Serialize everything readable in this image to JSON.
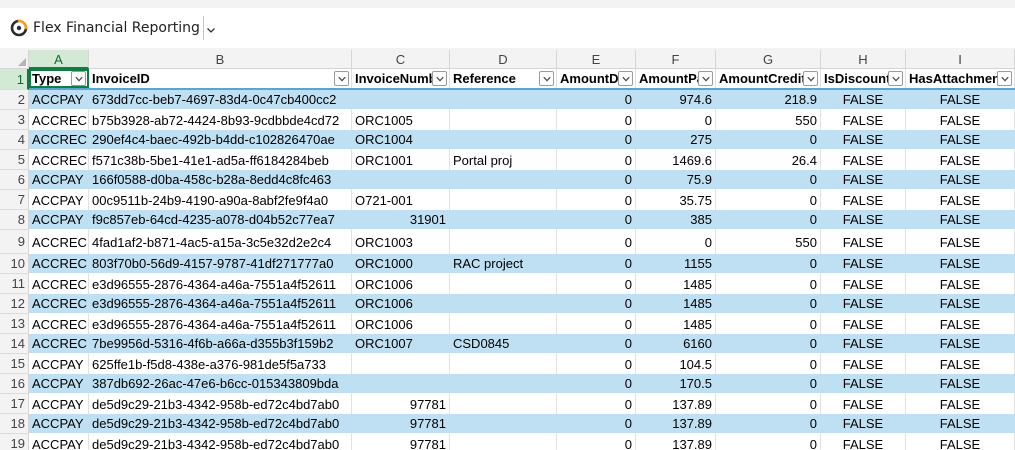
{
  "app": {
    "title": "Flex Financial Reporting",
    "logo_icon": "flex-logo-icon",
    "menu_icon": "chevron-down-icon"
  },
  "colors": {
    "band": "#bfe0f3",
    "selected_header": "#d3e9d6",
    "selected_accent": "#107c41",
    "table_header_rule": "#5ba4d0"
  },
  "column_letters": [
    "A",
    "B",
    "C",
    "D",
    "E",
    "F",
    "G",
    "H",
    "I"
  ],
  "selected_column": "A",
  "selected_row": "1",
  "row_numbers": [
    "1",
    "2",
    "3",
    "4",
    "5",
    "6",
    "7",
    "8",
    "9",
    "10",
    "11",
    "12",
    "13",
    "14",
    "15",
    "16",
    "17",
    "18",
    "19"
  ],
  "table": {
    "headers": [
      "Type",
      "InvoiceID",
      "InvoiceNumb",
      "Reference",
      "AmountDu",
      "AmountPa",
      "AmountCredite",
      "IsDiscounte",
      "HasAttachmen"
    ],
    "filter_icon": "filter-dropdown-icon",
    "rows": [
      [
        "ACCPAY",
        "673dd7cc-beb7-4697-83d4-0c47cb400cc2",
        "",
        "",
        "0",
        "974.6",
        "218.9",
        "FALSE",
        "FALSE"
      ],
      [
        "ACCREC",
        "b75b3928-ab72-4424-8b93-9cdbbde4cd72",
        "ORC1005",
        "",
        "0",
        "0",
        "550",
        "FALSE",
        "FALSE"
      ],
      [
        "ACCREC",
        "290ef4c4-baec-492b-b4dd-c102826470ae",
        "ORC1004",
        "",
        "0",
        "275",
        "0",
        "FALSE",
        "FALSE"
      ],
      [
        "ACCREC",
        "f571c38b-5be1-41e1-ad5a-ff6184284beb",
        "ORC1001",
        "Portal proj",
        "0",
        "1469.6",
        "26.4",
        "FALSE",
        "FALSE"
      ],
      [
        "ACCPAY",
        "166f0588-d0ba-458c-b28a-8edd4c8fc463",
        "",
        "",
        "0",
        "75.9",
        "0",
        "FALSE",
        "FALSE"
      ],
      [
        "ACCPAY",
        "00c9511b-24b9-4190-a90a-8abf2fe9f4a0",
        "O721-001",
        "",
        "0",
        "35.75",
        "0",
        "FALSE",
        "FALSE"
      ],
      [
        "ACCPAY",
        "f9c857eb-64cd-4235-a078-d04b52c77ea7",
        "31901",
        "",
        "0",
        "385",
        "0",
        "FALSE",
        "FALSE"
      ],
      [
        "ACCREC",
        "4fad1af2-b871-4ac5-a15a-3c5e32d2e2c4",
        "ORC1003",
        "",
        "0",
        "0",
        "550",
        "FALSE",
        "FALSE"
      ],
      [
        "ACCREC",
        "803f70b0-56d9-4157-9787-41df271777a0",
        "ORC1000",
        "RAC project",
        "0",
        "1155",
        "0",
        "FALSE",
        "FALSE"
      ],
      [
        "ACCREC",
        "e3d96555-2876-4364-a46a-7551a4f52611",
        "ORC1006",
        "",
        "0",
        "1485",
        "0",
        "FALSE",
        "FALSE"
      ],
      [
        "ACCREC",
        "e3d96555-2876-4364-a46a-7551a4f52611",
        "ORC1006",
        "",
        "0",
        "1485",
        "0",
        "FALSE",
        "FALSE"
      ],
      [
        "ACCREC",
        "e3d96555-2876-4364-a46a-7551a4f52611",
        "ORC1006",
        "",
        "0",
        "1485",
        "0",
        "FALSE",
        "FALSE"
      ],
      [
        "ACCREC",
        "7be9956d-5316-4f6b-a66a-d355b3f159b2",
        "ORC1007",
        "CSD0845",
        "0",
        "6160",
        "0",
        "FALSE",
        "FALSE"
      ],
      [
        "ACCPAY",
        "625ffe1b-f5d8-438e-a376-981de5f5a733",
        "",
        "",
        "0",
        "104.5",
        "0",
        "FALSE",
        "FALSE"
      ],
      [
        "ACCPAY",
        "387db692-26ac-47e6-b6cc-015343809bda",
        "",
        "",
        "0",
        "170.5",
        "0",
        "FALSE",
        "FALSE"
      ],
      [
        "ACCPAY",
        "de5d9c29-21b3-4342-958b-ed72c4bd7ab0",
        "97781",
        "",
        "0",
        "137.89",
        "0",
        "FALSE",
        "FALSE"
      ],
      [
        "ACCPAY",
        "de5d9c29-21b3-4342-958b-ed72c4bd7ab0",
        "97781",
        "",
        "0",
        "137.89",
        "0",
        "FALSE",
        "FALSE"
      ],
      [
        "ACCPAY",
        "de5d9c29-21b3-4342-958b-ed72c4bd7ab0",
        "97781",
        "",
        "0",
        "137.89",
        "0",
        "FALSE",
        "FALSE"
      ]
    ]
  }
}
